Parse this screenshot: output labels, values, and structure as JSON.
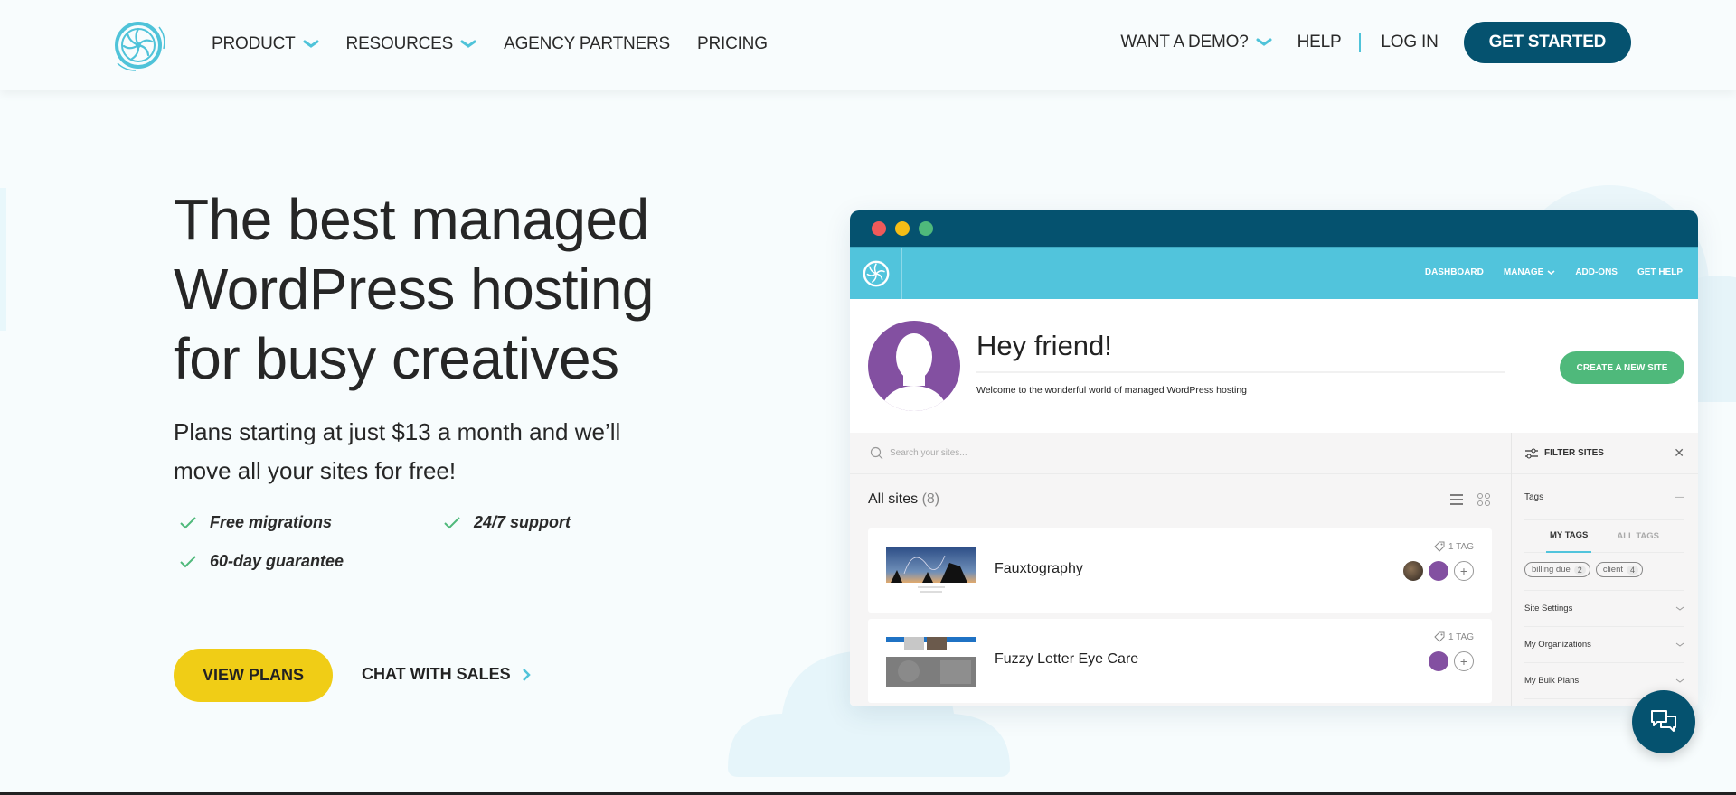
{
  "header": {
    "logo": "flywheel-logo-icon",
    "nav_left": [
      {
        "label": "PRODUCT",
        "has_dropdown": true
      },
      {
        "label": "RESOURCES",
        "has_dropdown": true
      },
      {
        "label": "AGENCY PARTNERS",
        "has_dropdown": false
      },
      {
        "label": "PRICING",
        "has_dropdown": false
      }
    ],
    "nav_right": {
      "demo": "WANT A DEMO?",
      "help": "HELP",
      "login": "LOG IN",
      "get_started": "GET STARTED"
    }
  },
  "hero": {
    "title_lines": [
      "The best managed",
      "WordPress hosting",
      "for busy creatives"
    ],
    "subtitle_lines": [
      "Plans starting at just $13 a month and we’ll",
      "move all your sites for free!"
    ],
    "features": [
      "Free migrations",
      "24/7 support",
      "60-day guarantee"
    ],
    "primary_cta": "VIEW PLANS",
    "secondary_cta": "CHAT WITH SALES"
  },
  "app_mock": {
    "window_dots": [
      "#f05a5a",
      "#f6bd16",
      "#4fb97b"
    ],
    "nav": [
      "DASHBOARD",
      "MANAGE",
      "ADD-ONS",
      "GET HELP"
    ],
    "greeting": "Hey friend!",
    "welcome_text": "Welcome to the wonderful world of managed WordPress hosting",
    "create_button": "CREATE A NEW SITE",
    "search_placeholder": "Search your sites...",
    "sites_title": "All sites",
    "sites_count": "(8)",
    "sites": [
      {
        "name": "Fauxtography",
        "tags": "1 TAG",
        "members": [
          "photo",
          "purple"
        ]
      },
      {
        "name": "Fuzzy Letter Eye Care",
        "tags": "1 TAG",
        "members": [
          "purple"
        ]
      }
    ],
    "filter": {
      "title": "FILTER SITES",
      "tags_label": "Tags",
      "tabs": [
        "MY TAGS",
        "ALL TAGS"
      ],
      "active_tab": "MY TAGS",
      "chips": [
        {
          "label": "billing due",
          "count": "2"
        },
        {
          "label": "client",
          "count": "4"
        }
      ],
      "sections": [
        "Site Settings",
        "My Organizations",
        "My Bulk Plans"
      ]
    }
  },
  "colors": {
    "brand_dark": "#05526f",
    "brand_cyan": "#51c4dc",
    "cta_yellow": "#f0cd16",
    "success_green": "#4fb97b",
    "avatar_purple": "#8350a1"
  }
}
